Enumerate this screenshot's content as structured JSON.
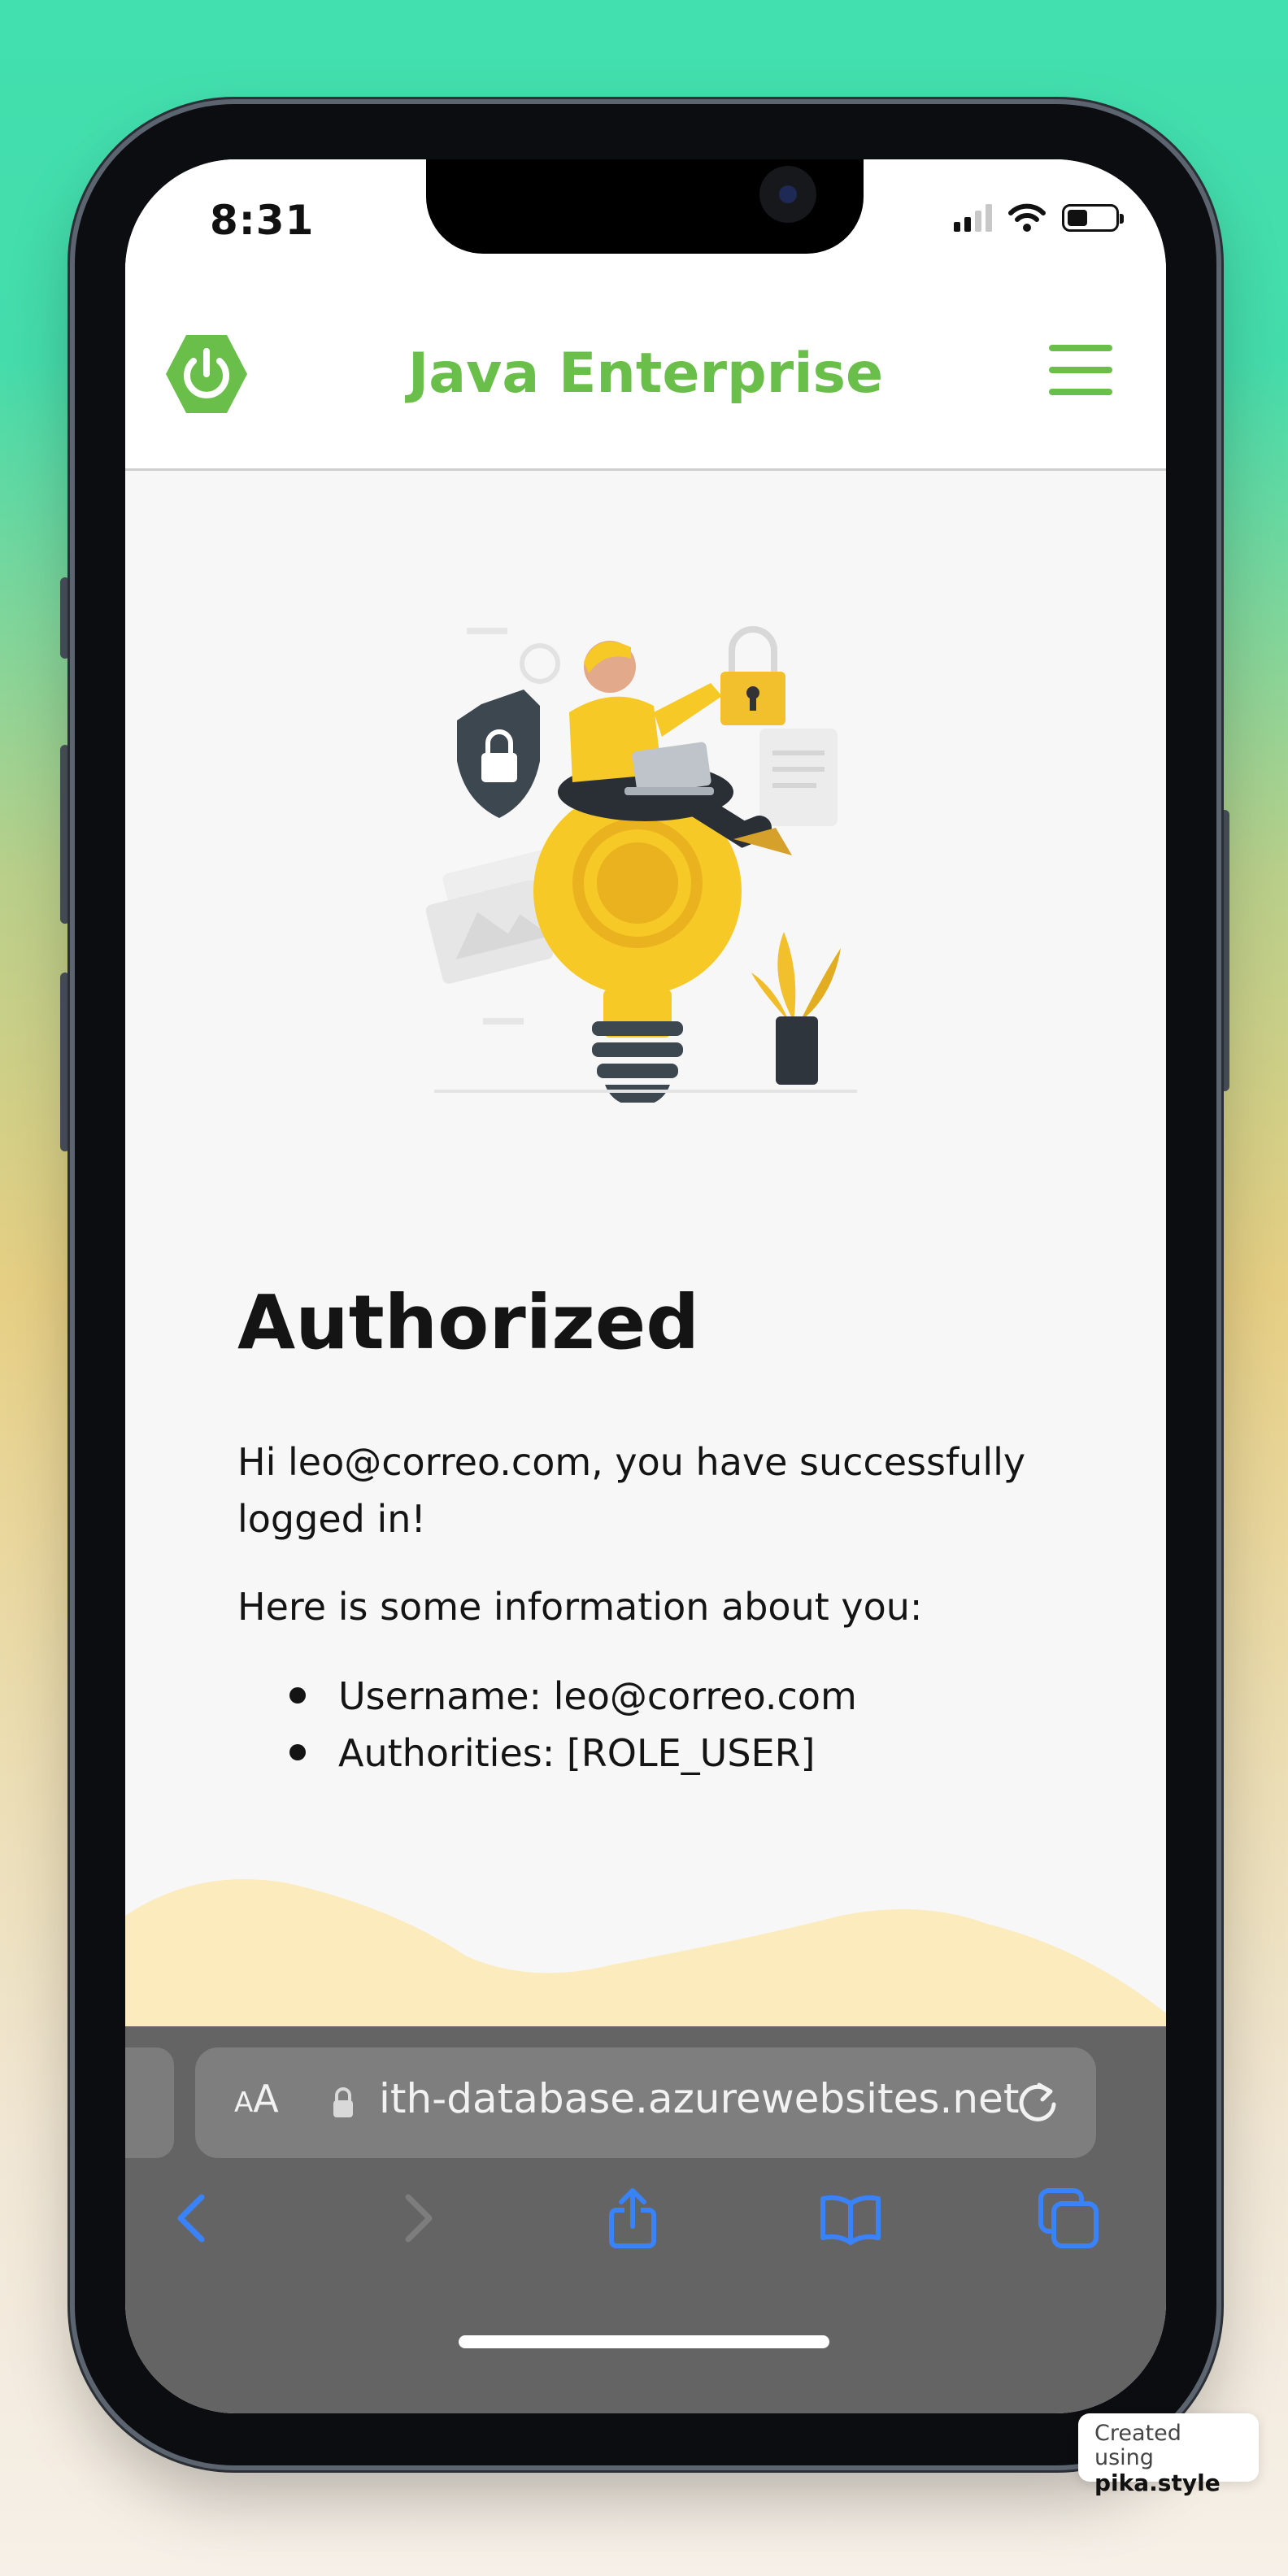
{
  "status_bar": {
    "time": "8:31"
  },
  "navbar": {
    "brand": "Java Enterprise"
  },
  "main": {
    "title": "Authorized",
    "greeting": "Hi leo@correo.com, you have successfully logged in!",
    "info_intro": "Here is some information about you:",
    "info_items": [
      "Username: leo@correo.com",
      "Authorities: [ROLE_USER]"
    ]
  },
  "browser": {
    "text_size_label_small": "A",
    "text_size_label_large": "A",
    "url": "ith-database.azurewebsites.net"
  },
  "watermark": {
    "line1": "Created using",
    "line2": "pika.style"
  },
  "colors": {
    "brand_green": "#6abf4b",
    "safari_accent": "#3a82f7",
    "wave_fill": "#fbebbd"
  },
  "icons": {
    "logo": "power-icon",
    "menu": "hamburger-menu-icon",
    "back": "chevron-left-icon",
    "forward": "chevron-right-icon",
    "share": "share-icon",
    "bookmarks": "book-icon",
    "tabs": "tabs-icon",
    "reload": "reload-icon",
    "lock": "lock-icon"
  }
}
